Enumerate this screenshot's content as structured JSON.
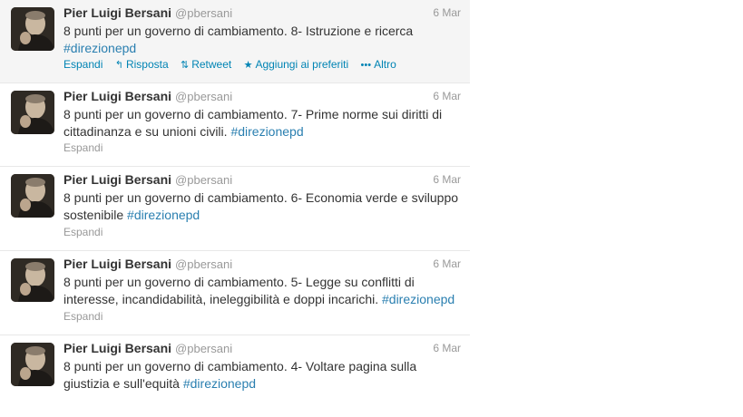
{
  "tweets": [
    {
      "name": "Pier Luigi Bersani",
      "handle": "@pbersani",
      "date": "6 Mar",
      "text": "8 punti per un governo di cambiamento. 8-  Istruzione e ricerca",
      "hashtag": "#direzionepd",
      "hashtag_newline": true,
      "expand": "Espandi",
      "hover": true,
      "actions": {
        "reply": "Risposta",
        "retweet": "Retweet",
        "favorite": "Aggiungi ai preferiti",
        "more": "Altro"
      }
    },
    {
      "name": "Pier Luigi Bersani",
      "handle": "@pbersani",
      "date": "6 Mar",
      "text": "8 punti per un governo di cambiamento. 7- Prime norme sui diritti di cittadinanza e su unioni civili.",
      "hashtag": "#direzionepd",
      "expand": "Espandi"
    },
    {
      "name": "Pier Luigi Bersani",
      "handle": "@pbersani",
      "date": "6 Mar",
      "text": "8 punti per un governo di cambiamento. 6- Economia verde e sviluppo sostenibile",
      "hashtag": "#direzionepd",
      "expand": "Espandi"
    },
    {
      "name": "Pier Luigi Bersani",
      "handle": "@pbersani",
      "date": "6 Mar",
      "text": "8 punti per un governo di cambiamento. 5- Legge su conflitti di interesse, incandidabilità, ineleggibilità e doppi incarichi.",
      "hashtag": "#direzionepd",
      "expand": "Espandi"
    },
    {
      "name": "Pier Luigi Bersani",
      "handle": "@pbersani",
      "date": "6 Mar",
      "text": "8 punti per un governo di cambiamento. 4- Voltare pagina sulla giustizia e sull'equità",
      "hashtag": "#direzionepd"
    }
  ],
  "colors": {
    "link": "#0084b4",
    "hashtag": "#2a7fb0",
    "muted": "#999999",
    "hover_bg": "#f5f5f5"
  },
  "icons": {
    "reply": "reply-arrow-icon",
    "retweet": "retweet-icon",
    "favorite": "star-icon",
    "more": "more-dots-icon"
  }
}
